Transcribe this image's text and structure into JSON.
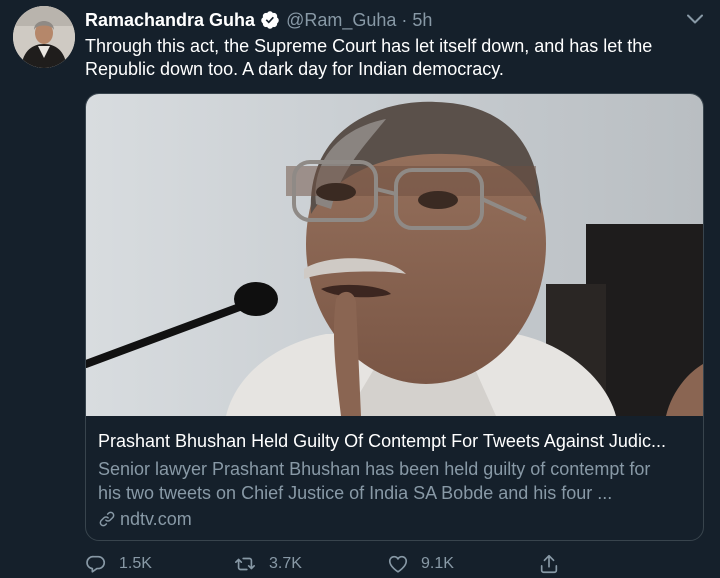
{
  "tweet": {
    "author_name": "Ramachandra Guha",
    "handle": "@Ram_Guha",
    "separator": "·",
    "time": "5h",
    "text": "Through this act, the Supreme Court has let itself down, and has let the Republic down too. A dark day for Indian democracy."
  },
  "card": {
    "title": "Prashant Bhushan Held Guilty Of Contempt For Tweets Against Judic...",
    "description_line1": "Senior lawyer Prashant Bhushan has been held guilty of contempt for",
    "description_line2": "his two tweets on Chief Justice of India SA Bobde and his four ...",
    "domain": "ndtv.com"
  },
  "actions": {
    "replies": "1.5K",
    "retweets": "3.7K",
    "likes": "9.1K"
  },
  "colors": {
    "background": "#15202b",
    "border": "#38444d",
    "secondary_text": "#8899a6",
    "verified_blue": "#1da1f2"
  },
  "icons": [
    "verified-badge-icon",
    "chevron-down-icon",
    "link-icon",
    "reply-icon",
    "retweet-icon",
    "like-icon",
    "share-icon"
  ]
}
